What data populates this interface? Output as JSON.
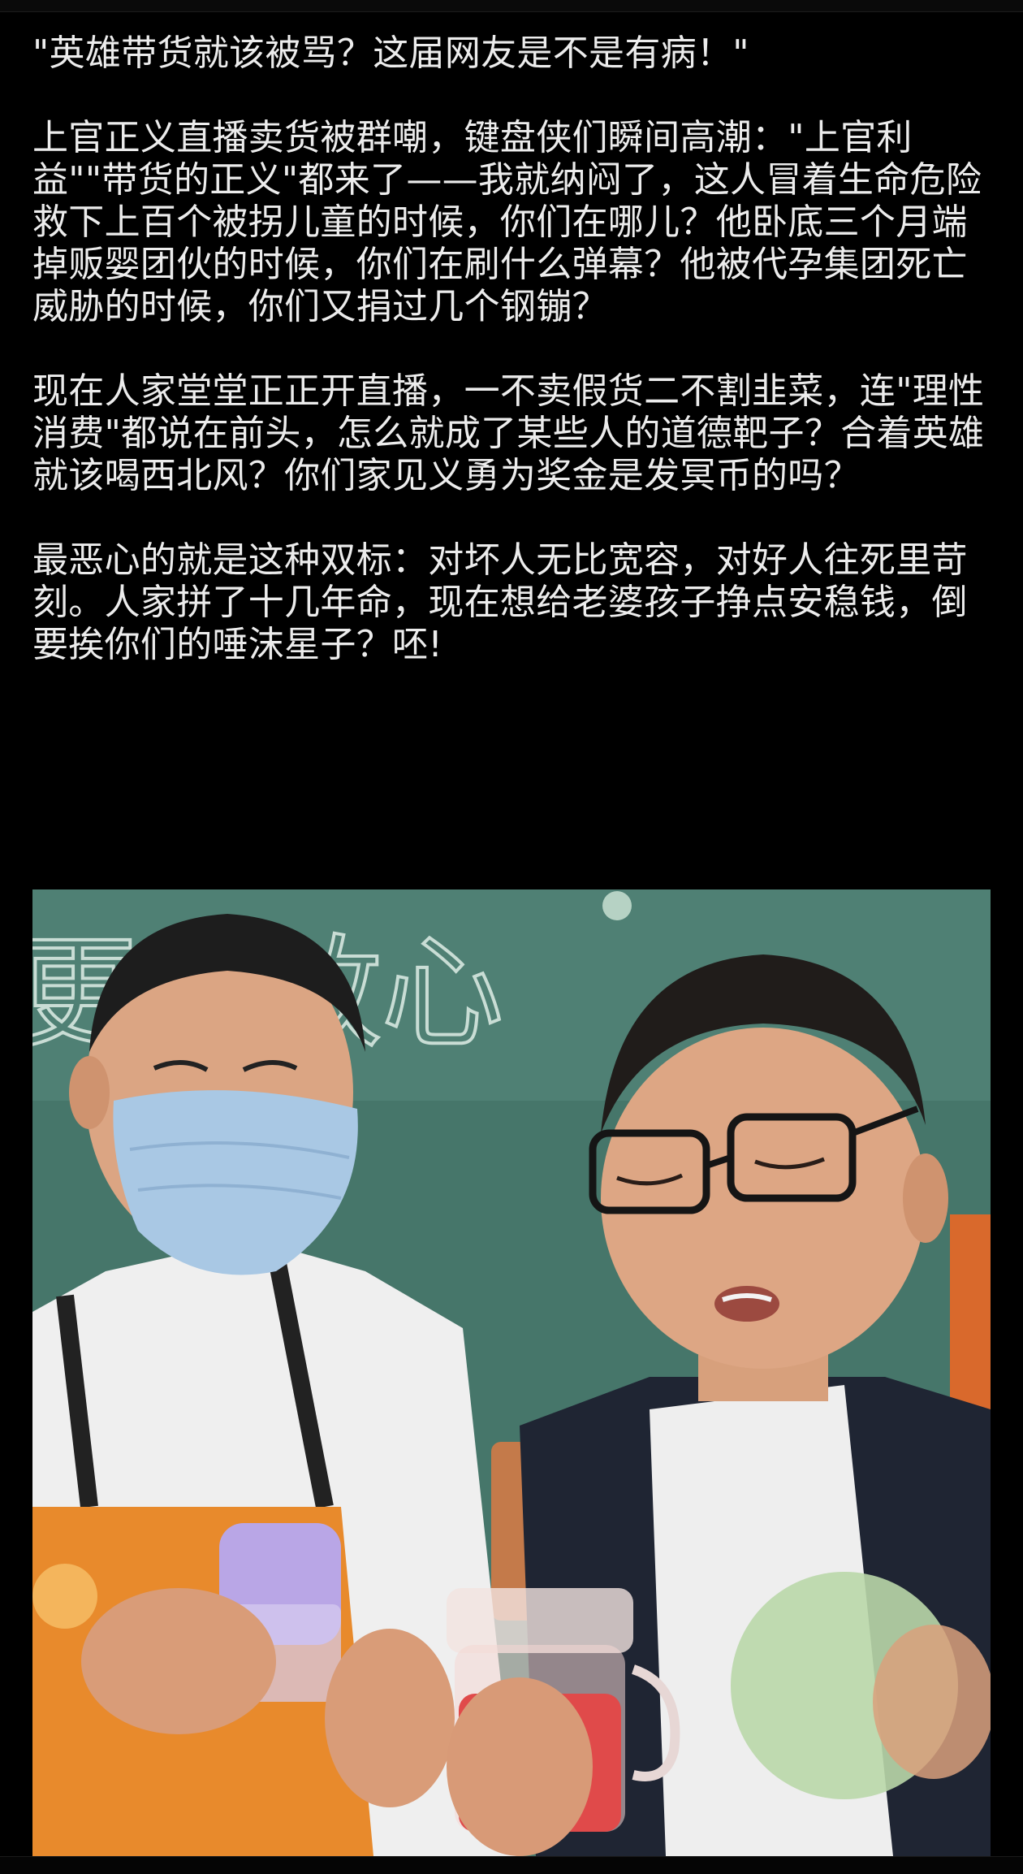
{
  "post": {
    "title": "\"英雄带货就该被骂？这届网友是不是有病！\"",
    "paragraphs": [
      "上官正义直播卖货被群嘲，键盘侠们瞬间高潮：\"上官利益\"\"带货的正义\"都来了——我就纳闷了，这人冒着生命危险救下上百个被拐儿童的时候，你们在哪儿？他卧底三个月端掉贩婴团伙的时候，你们在刷什么弹幕？他被代孕集团死亡威胁的时候，你们又捐过几个钢镚？",
      "现在人家堂堂正正开直播，一不卖假货二不割韭菜，连\"理性消费\"都说在前头，怎么就成了某些人的道德靶子？合着英雄就该喝西北风？你们家见义勇为奖金是发冥币的吗？",
      "最恶心的就是这种双标：对坏人无比宽容，对好人往死里苛刻。人家拼了十几年命，现在想给老婆孩子挣点安稳钱，倒要挨你们的唾沫星子？呸!"
    ]
  },
  "photo": {
    "background_sign_text": "更鲜放心",
    "colors": {
      "wall": "#46766a",
      "mask": "#a9c8e4",
      "apron": "#e88a2c",
      "juice": "#e04a4a",
      "cup_lid": "#b9a6e6"
    }
  }
}
